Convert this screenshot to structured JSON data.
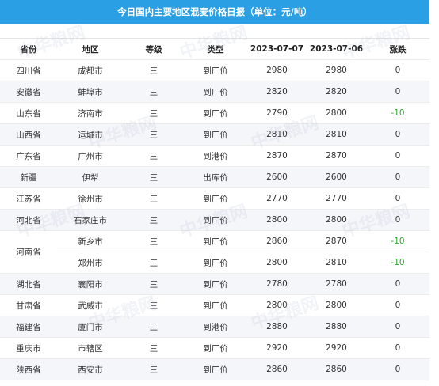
{
  "title": "今日国内主要地区混麦价格日报（单位：元/吨）",
  "watermark_text": "中华粮网",
  "headers": {
    "province": "省份",
    "region": "地区",
    "grade": "等级",
    "type": "类型",
    "date1": "2023-07-07",
    "date2": "2023-07-06",
    "change": "涨跌"
  },
  "rows": [
    {
      "province": "四川省",
      "region": "成都市",
      "grade": "三",
      "type": "到厂价",
      "p1": "2980",
      "p2": "2980",
      "change": "0"
    },
    {
      "province": "安徽省",
      "region": "蚌埠市",
      "grade": "三",
      "type": "到厂价",
      "p1": "2820",
      "p2": "2820",
      "change": "0"
    },
    {
      "province": "山东省",
      "region": "济南市",
      "grade": "三",
      "type": "到厂价",
      "p1": "2790",
      "p2": "2800",
      "change": "-10"
    },
    {
      "province": "山西省",
      "region": "运城市",
      "grade": "三",
      "type": "到厂价",
      "p1": "2810",
      "p2": "2810",
      "change": "0"
    },
    {
      "province": "广东省",
      "region": "广州市",
      "grade": "三",
      "type": "到港价",
      "p1": "2870",
      "p2": "2870",
      "change": "0"
    },
    {
      "province": "新疆",
      "region": "伊犁",
      "grade": "三",
      "type": "出库价",
      "p1": "2600",
      "p2": "2600",
      "change": "0"
    },
    {
      "province": "江苏省",
      "region": "徐州市",
      "grade": "三",
      "type": "到厂价",
      "p1": "2770",
      "p2": "2770",
      "change": "0"
    },
    {
      "province": "河北省",
      "region": "石家庄市",
      "grade": "三",
      "type": "到厂价",
      "p1": "2800",
      "p2": "2800",
      "change": "0"
    }
  ],
  "merged": {
    "province": "河南省",
    "rows": [
      {
        "region": "新乡市",
        "grade": "三",
        "type": "到厂价",
        "p1": "2860",
        "p2": "2870",
        "change": "-10"
      },
      {
        "region": "郑州市",
        "grade": "三",
        "type": "到厂价",
        "p1": "2800",
        "p2": "2810",
        "change": "-10"
      }
    ]
  },
  "rows_after": [
    {
      "province": "湖北省",
      "region": "襄阳市",
      "grade": "三",
      "type": "到厂价",
      "p1": "2780",
      "p2": "2780",
      "change": "0"
    },
    {
      "province": "甘肃省",
      "region": "武威市",
      "grade": "三",
      "type": "到厂价",
      "p1": "2800",
      "p2": "2800",
      "change": "0"
    },
    {
      "province": "福建省",
      "region": "厦门市",
      "grade": "三",
      "type": "到港价",
      "p1": "2880",
      "p2": "2880",
      "change": "0"
    },
    {
      "province": "重庆市",
      "region": "市辖区",
      "grade": "三",
      "type": "到厂价",
      "p1": "2920",
      "p2": "2920",
      "change": "0"
    },
    {
      "province": "陕西省",
      "region": "西安市",
      "grade": "三",
      "type": "到厂价",
      "p1": "2860",
      "p2": "2860",
      "change": "0"
    }
  ],
  "colors": {
    "title_bg": "#2a9fe4",
    "negative_change": "#2ea32e",
    "stripe": "#f4f6fa"
  }
}
